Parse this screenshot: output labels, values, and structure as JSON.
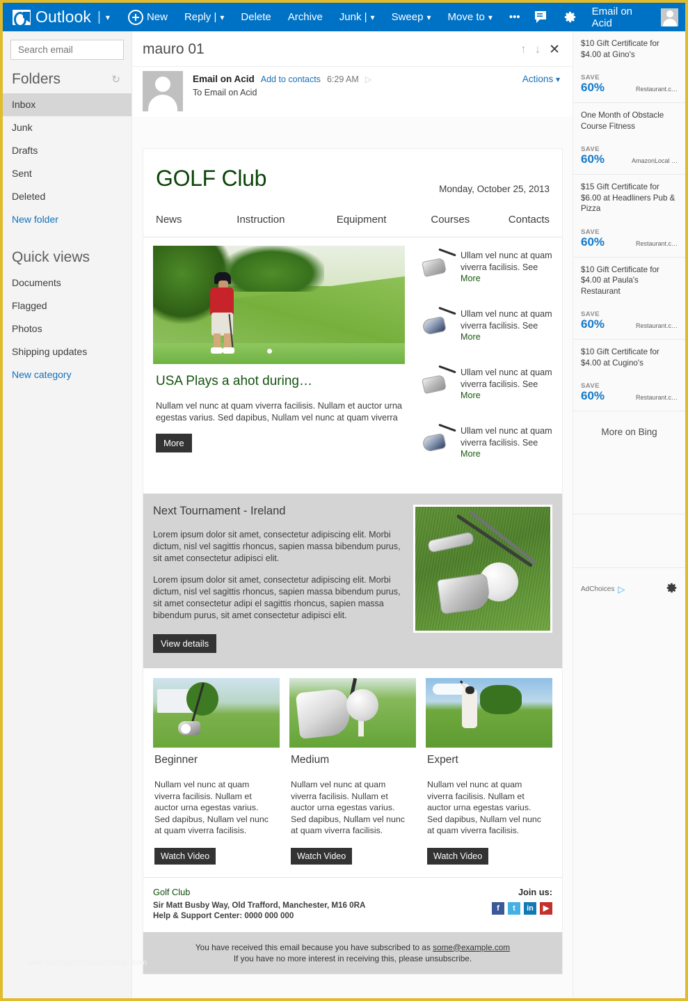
{
  "topbar": {
    "brand": "Outlook",
    "items": [
      "New",
      "Reply |",
      "Delete",
      "Archive",
      "Junk |",
      "Sweep",
      "Move to",
      "•••"
    ],
    "new_label": "New",
    "reply_label": "Reply |",
    "delete_label": "Delete",
    "archive_label": "Archive",
    "junk_label": "Junk |",
    "sweep_label": "Sweep",
    "moveto_label": "Move to",
    "overflow_label": "•••",
    "account_name": "Email on Acid",
    "accent": "#0072c6"
  },
  "sidebar": {
    "search_placeholder": "Search email",
    "folders_heading": "Folders",
    "folders": [
      {
        "label": "Inbox",
        "active": true
      },
      {
        "label": "Junk",
        "active": false
      },
      {
        "label": "Drafts",
        "active": false
      },
      {
        "label": "Sent",
        "active": false
      },
      {
        "label": "Deleted",
        "active": false
      }
    ],
    "new_folder": "New folder",
    "quick_views_heading": "Quick views",
    "quick_views": [
      "Documents",
      "Flagged",
      "Photos",
      "Shipping updates"
    ],
    "new_category": "New category"
  },
  "message": {
    "subject": "mauro 01",
    "sender": "Email on Acid",
    "add_to_contacts": "Add to contacts",
    "time": "6:29 AM",
    "to_line": "To Email on Acid",
    "actions_label": "Actions"
  },
  "newsletter": {
    "logo": "GOLF Club",
    "date": "Monday, October 25, 2013",
    "nav": [
      "News",
      "Instruction",
      "Equipment",
      "Courses",
      "Contacts"
    ],
    "headline": "USA Plays a ahot during…",
    "lead": "Nullam vel nunc at quam viverra facilisis. Nullam et auctor urna egestas varius. Sed dapibus, Nullam vel nunc at quam viverra",
    "more_button": "More",
    "side_items": [
      {
        "text": "Ullam vel nunc at quam viverra facilisis.",
        "see": "See ",
        "more": "More",
        "style": "silver"
      },
      {
        "text": "Ullam vel nunc at quam viverra facilisis.",
        "see": "See ",
        "more": "More",
        "style": "blue"
      },
      {
        "text": "Ullam vel nunc at quam viverra facilisis.",
        "see": "See ",
        "more": "More",
        "style": "silver"
      },
      {
        "text": "Ullam vel nunc at quam viverra facilisis.",
        "see": "See ",
        "more": "More",
        "style": "blue"
      }
    ],
    "tournament": {
      "heading": "Next Tournament - Ireland",
      "para1": "Lorem ipsum dolor sit amet, consectetur adipiscing elit. Morbi dictum, nisl vel sagittis rhoncus, sapien massa bibendum purus, sit amet consectetur adipisci elit.",
      "para2": "Lorem ipsum dolor sit amet, consectetur adipiscing elit. Morbi dictum, nisl vel sagittis rhoncus, sapien massa bibendum purus, sit amet consectetur adipi el sagittis rhoncus, sapien massa bibendum purus, sit amet consectetur adipisci elit.",
      "button": "View details"
    },
    "levels": [
      {
        "title": "Beginner",
        "body": "Nullam vel nunc at quam viverra facilisis. Nullam et auctor urna egestas varius. Sed dapibus, Nullam vel nunc at quam viverra facilisis.",
        "button": "Watch Video"
      },
      {
        "title": "Medium",
        "body": "Nullam vel nunc at quam viverra facilisis. Nullam et auctor urna egestas varius. Sed dapibus, Nullam vel nunc at quam viverra facilisis.",
        "button": "Watch Video"
      },
      {
        "title": "Expert",
        "body": "Nullam vel nunc at quam viverra facilisis. Nullam et auctor urna egestas varius. Sed dapibus, Nullam vel nunc at quam viverra facilisis.",
        "button": "Watch Video"
      }
    ],
    "footer": {
      "name": "Golf Club",
      "address": "Sir Matt Busby Way, Old Trafford, Manchester, M16 0RA",
      "support": "Help & Support Center: 0000 000 000",
      "join_label": "Join us:",
      "socials": [
        "f",
        "t",
        "in",
        "▶"
      ]
    },
    "disclaimer": {
      "line1_pre": "You have received this email because you have subscribed to as ",
      "line1_link": "some@example.com",
      "line2": "If you have no more interest in receiving this, please unsubscribe."
    },
    "watermark": "www.heritagechristiancollege.com"
  },
  "ads": {
    "items": [
      {
        "title": "$10 Gift Certificate for $4.00 at Gino's",
        "save_label": "SAVE",
        "percent": "60%",
        "source": "Restaurant.c…"
      },
      {
        "title": "One Month of Obstacle Course Fitness",
        "save_label": "SAVE",
        "percent": "60%",
        "source": "AmazonLocal …"
      },
      {
        "title": "$15 Gift Certificate for $6.00 at Headliners Pub & Pizza",
        "save_label": "SAVE",
        "percent": "60%",
        "source": "Restaurant.c…"
      },
      {
        "title": "$10 Gift Certificate for $4.00 at Paula's Restaurant",
        "save_label": "SAVE",
        "percent": "60%",
        "source": "Restaurant.c…"
      },
      {
        "title": "$10 Gift Certificate for $4.00 at Cugino's",
        "save_label": "SAVE",
        "percent": "60%",
        "source": "Restaurant.c…"
      }
    ],
    "more_on_bing": "More on Bing",
    "adchoices_label": "AdChoices",
    "accent_blue": "#1179c9"
  }
}
